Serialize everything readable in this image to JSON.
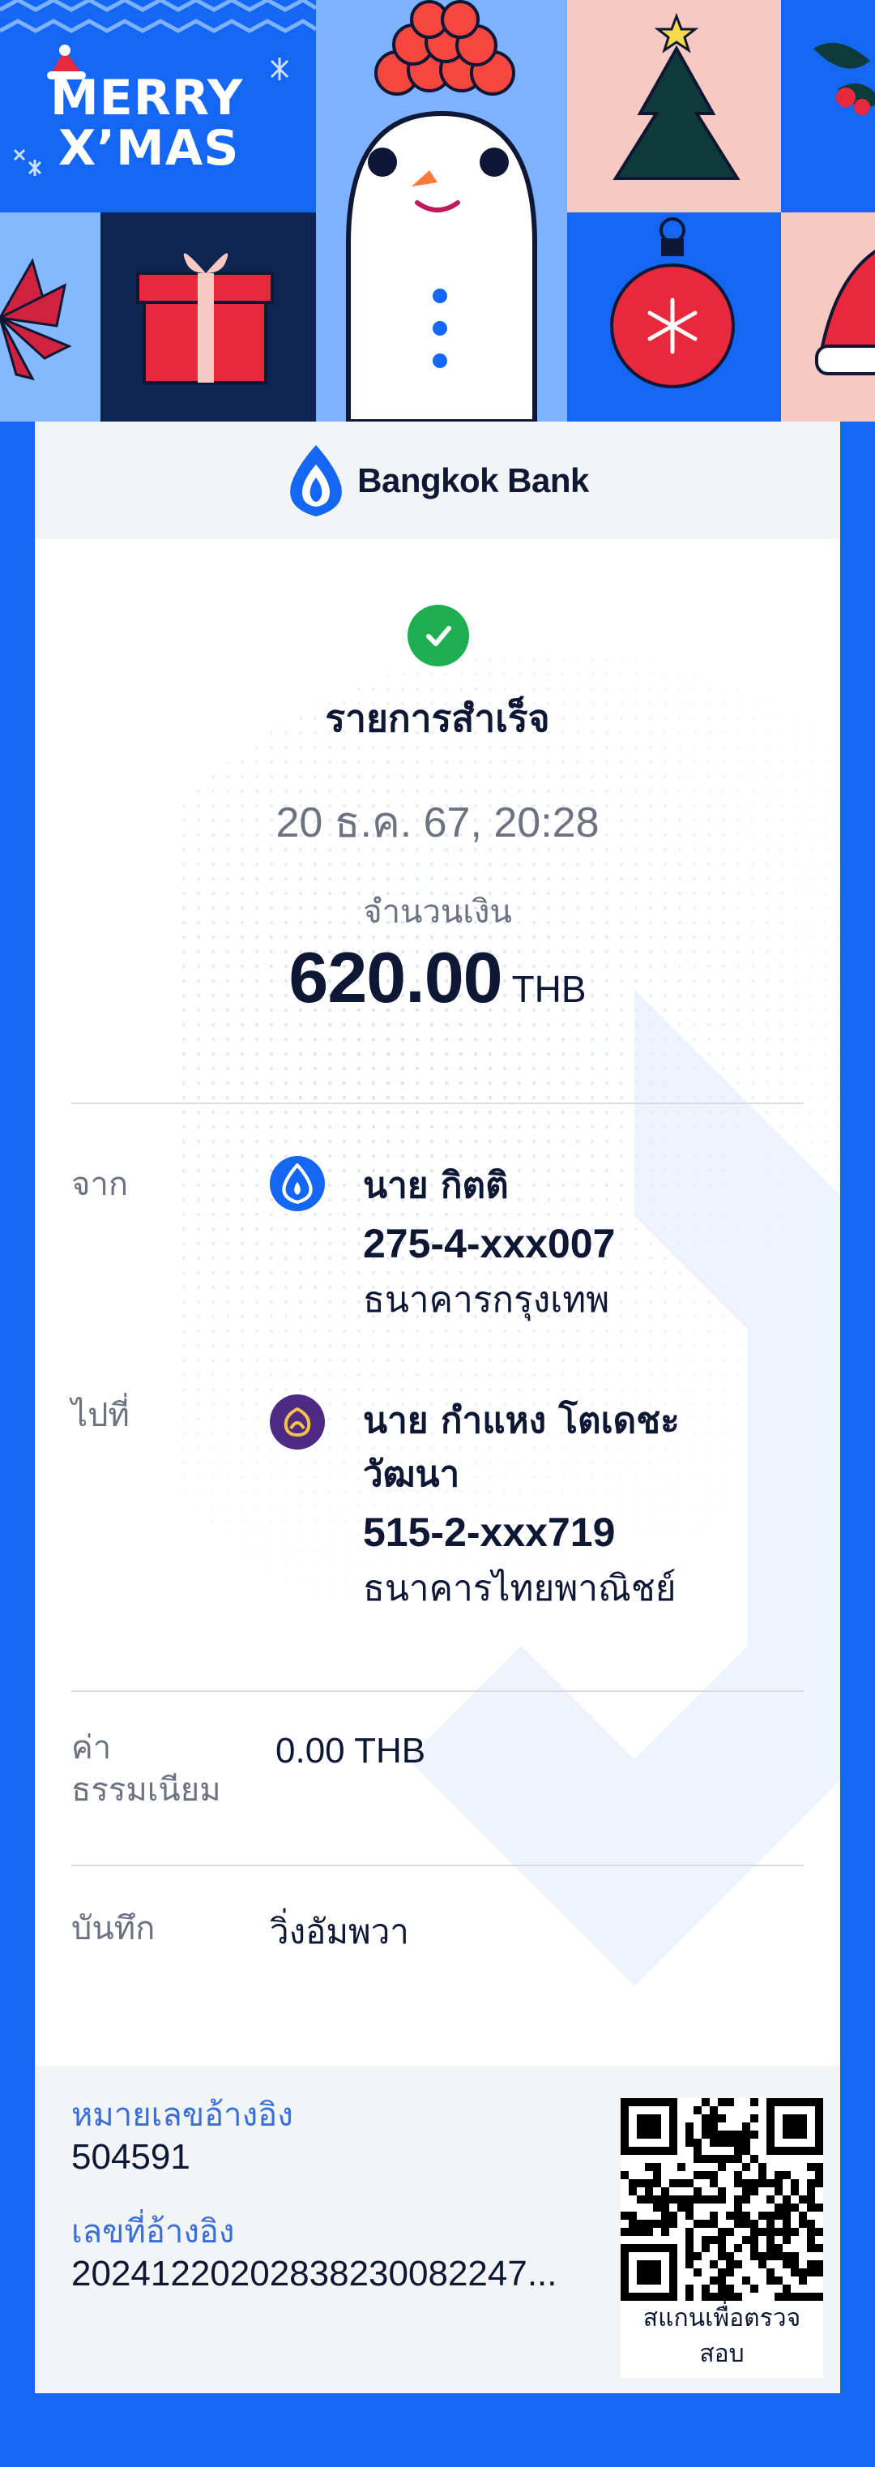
{
  "banner": {
    "greeting_line1": "MERRY",
    "greeting_line2": "X’MAS"
  },
  "header": {
    "bank_name": "Bangkok Bank",
    "logo_icon": "bangkok-bank-logo-icon"
  },
  "status": {
    "icon": "check-icon",
    "title": "รายการสำเร็จ",
    "datetime": "20 ธ.ค. 67, 20:28"
  },
  "amount": {
    "label": "จำนวนเงิน",
    "value": "620.00",
    "currency": "THB"
  },
  "from": {
    "label": "จาก",
    "name": "นาย กิตติ",
    "account": "275-4-xxx007",
    "bank": "ธนาคารกรุงเทพ",
    "icon": "bangkok-bank-icon"
  },
  "to": {
    "label": "ไปที่",
    "name_line1": "นาย กำแหง โตเดชะ",
    "name_line2": "วัฒนา",
    "account": "515-2-xxx719",
    "bank": "ธนาคารไทยพาณิชย์",
    "icon": "scb-bank-icon"
  },
  "fee": {
    "label_line1": "ค่า",
    "label_line2": "ธรรมเนียม",
    "value": "0.00 THB"
  },
  "memo": {
    "label": "บันทึก",
    "value": "วิ่งอัมพวา"
  },
  "reference": {
    "ref_no_label": "หมายเลขอ้างอิง",
    "ref_no": "504591",
    "ref_id_label": "เลขที่อ้างอิง",
    "ref_id": "202412202028382300822​47...",
    "qr_caption_line1": "สแกนเพื่อตรวจ",
    "qr_caption_line2": "สอบ"
  },
  "colors": {
    "brand_blue": "#1466f5",
    "success_green": "#1fae52",
    "scb_purple": "#4e2a84",
    "text_dark": "#0e1733",
    "text_muted": "#6c7280"
  }
}
